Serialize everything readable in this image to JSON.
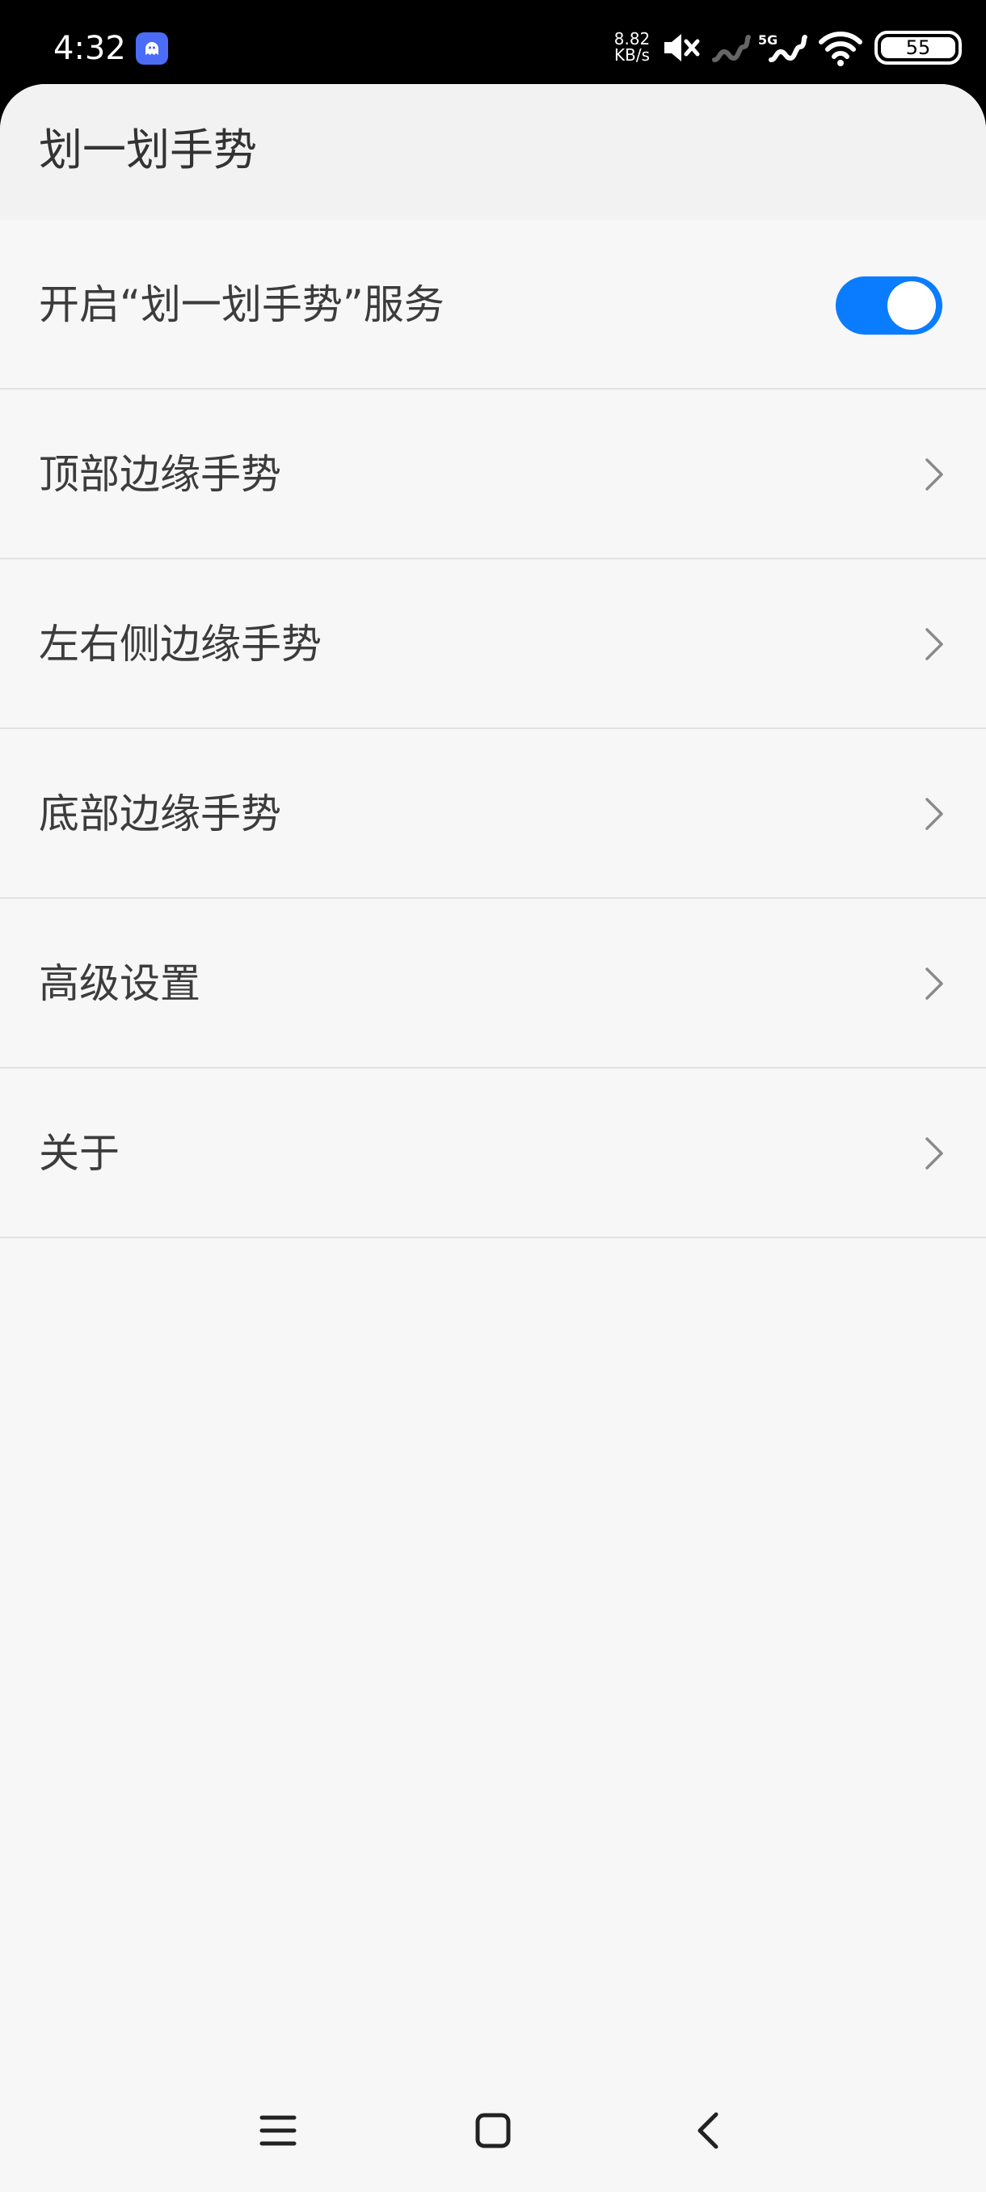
{
  "status_bar": {
    "time": "4:32",
    "net_speed_value": "8.82",
    "net_speed_unit": "KB/s",
    "signal_label": "5G",
    "battery": "55",
    "icons": [
      "app-notification-icon",
      "mute-icon",
      "signal-1-icon",
      "signal-5g-icon",
      "wifi-icon",
      "battery-icon"
    ]
  },
  "header": {
    "title": "划一划手势"
  },
  "settings": {
    "items": [
      {
        "label": "开启“划一划手势”服务",
        "type": "toggle",
        "enabled": true
      },
      {
        "label": "顶部边缘手势",
        "type": "link"
      },
      {
        "label": "左右侧边缘手势",
        "type": "link"
      },
      {
        "label": "底部边缘手势",
        "type": "link"
      },
      {
        "label": "高级设置",
        "type": "link"
      },
      {
        "label": "关于",
        "type": "link"
      }
    ]
  },
  "nav_bar": {
    "buttons": [
      "menu-icon",
      "home-icon",
      "back-icon"
    ]
  },
  "colors": {
    "accent": "#0a7cff",
    "background": "#f7f7f7",
    "header_background": "#f2f2f2",
    "divider": "#e2e2e2",
    "text": "#3c3c3c"
  }
}
